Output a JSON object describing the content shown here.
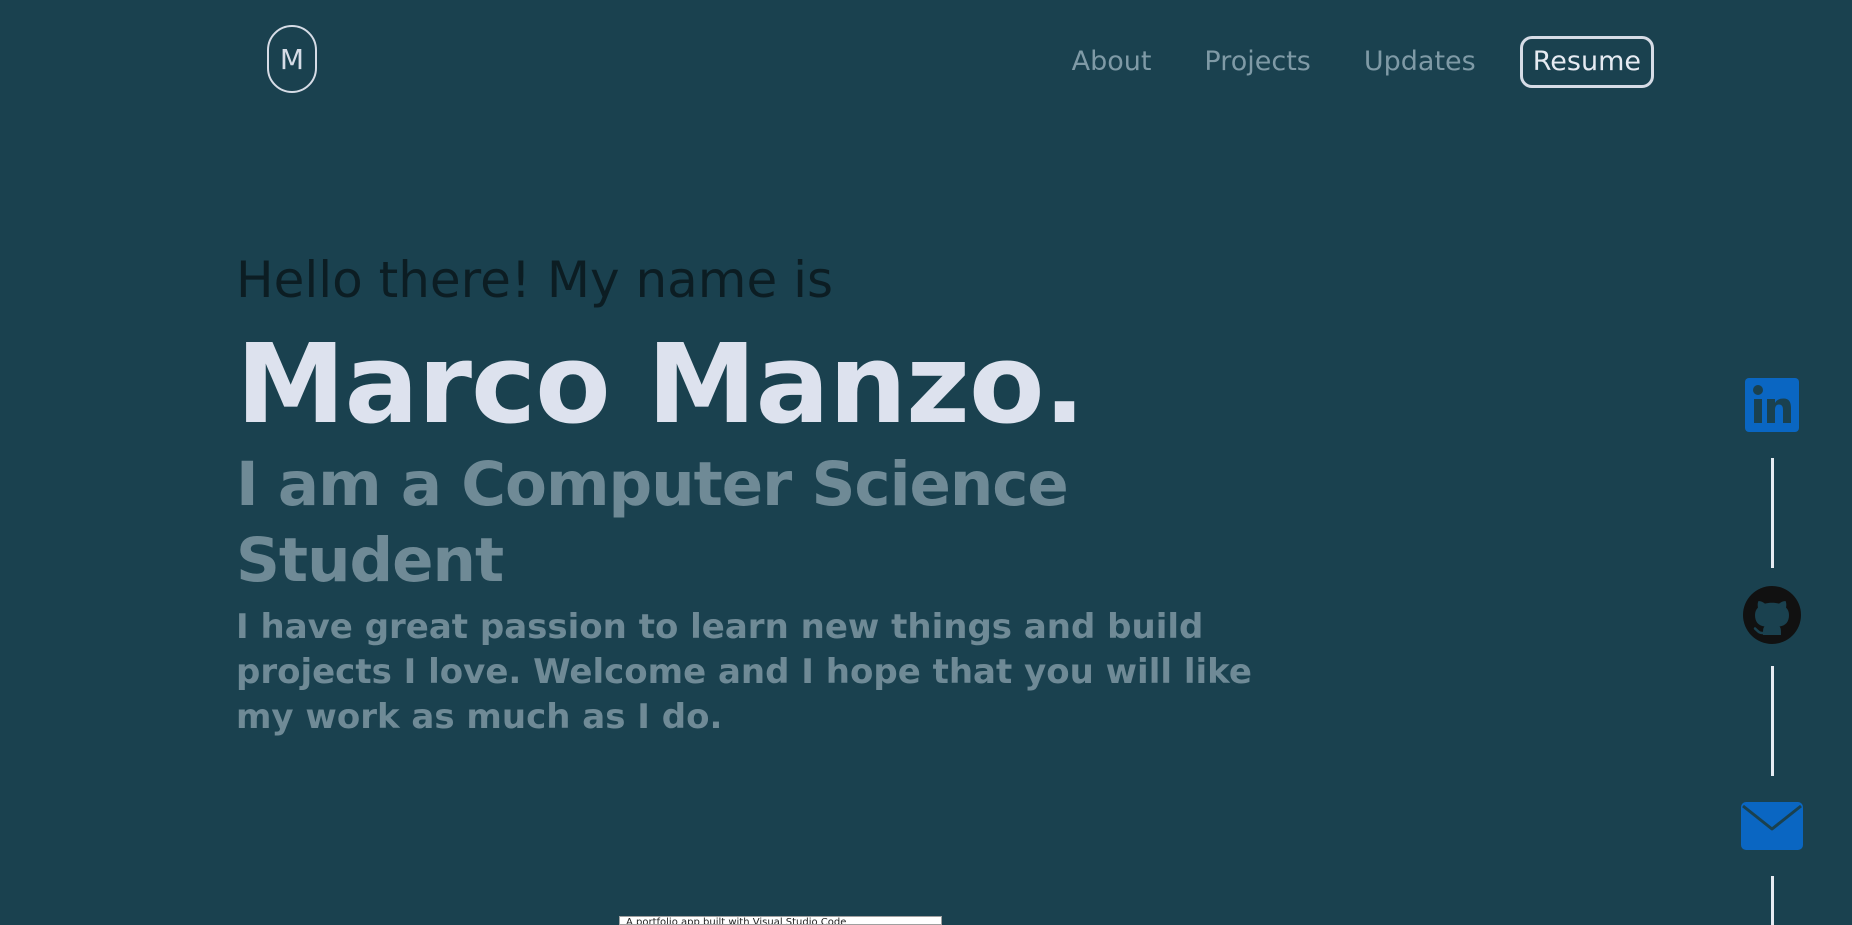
{
  "header": {
    "logo_letter": "M",
    "nav": {
      "about": "About",
      "projects": "Projects",
      "updates": "Updates",
      "resume": "Resume"
    }
  },
  "hero": {
    "greeting": "Hello there! My name is",
    "name": "Marco Manzo.",
    "role": "I am a Computer Science Student",
    "description": "I have great passion to learn new things and build projects I love. Welcome and I hope that you will like my work as much as I do."
  },
  "social": {
    "icons": [
      "linkedin-icon",
      "github-icon",
      "email-icon"
    ],
    "linkedin_label": "in"
  },
  "tooltip": {
    "text": "A portfolio app built with Visual Studio Code"
  },
  "colors": {
    "background": "#1a414f",
    "name_text": "#dde2ee",
    "muted_text": "#6f8a96",
    "greeting_text": "#0c1d23",
    "social_blue": "#0a66c2",
    "github_dark": "#111111"
  }
}
